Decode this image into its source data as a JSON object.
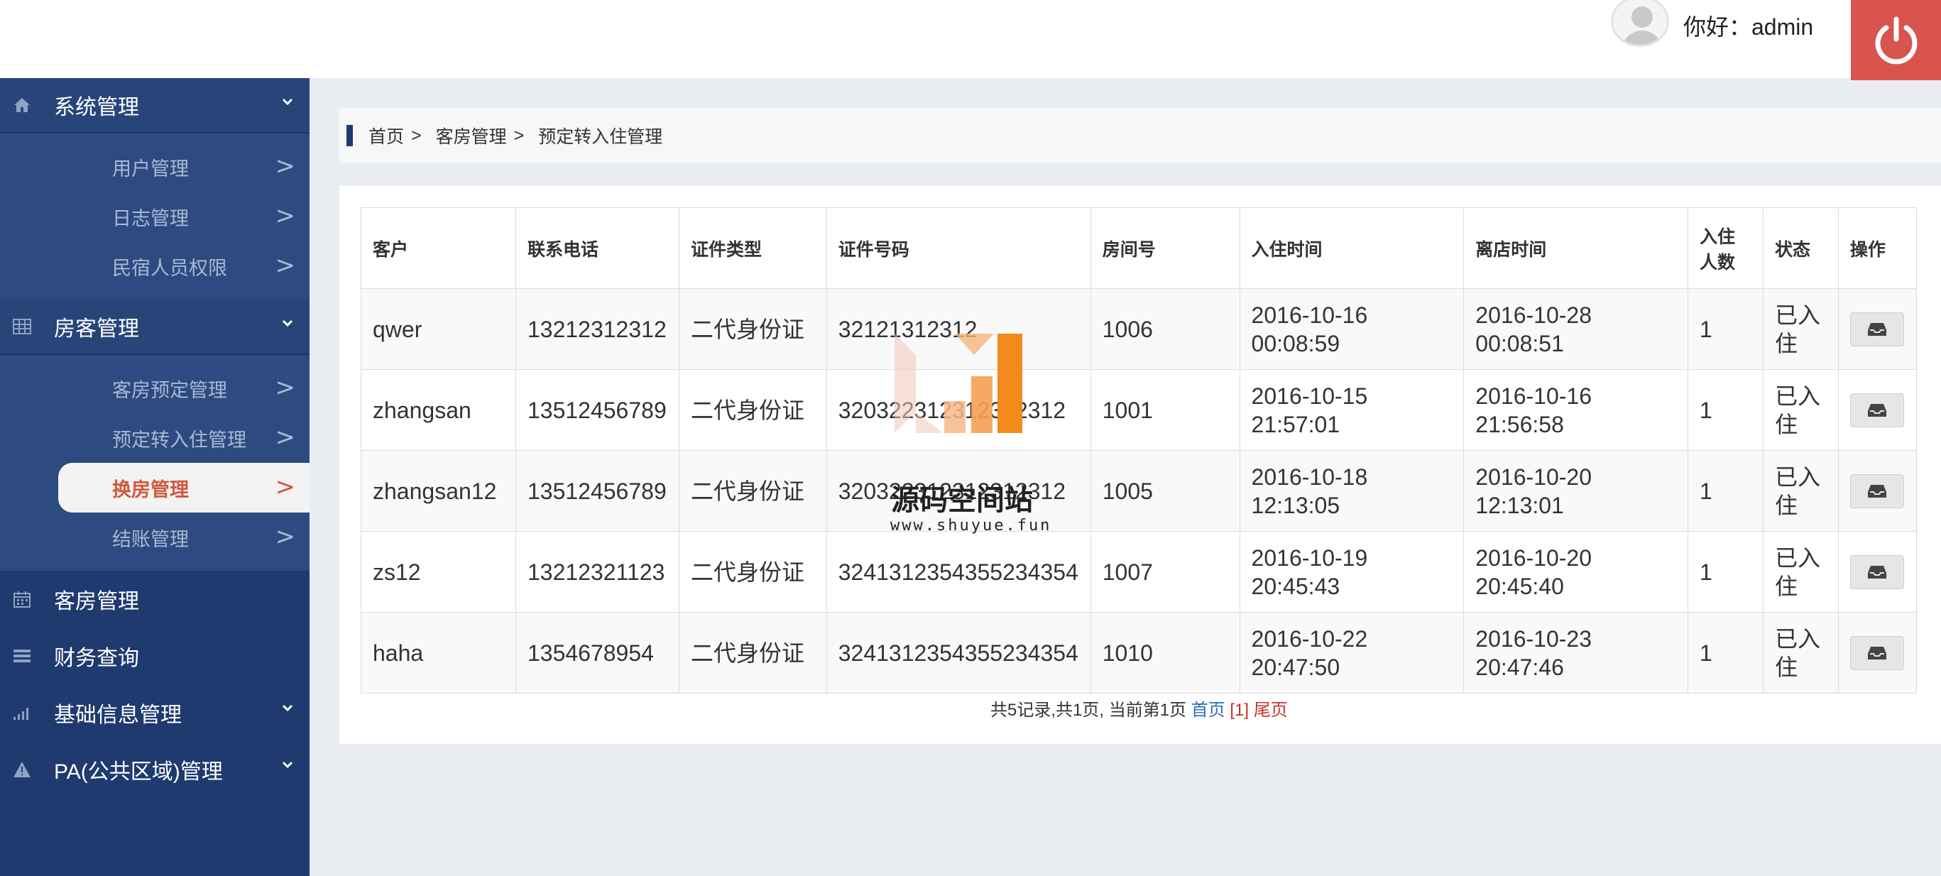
{
  "header": {
    "greeting": "你好：admin"
  },
  "sidebar": {
    "groups": [
      {
        "label": "系统管理",
        "icon": "home-icon"
      },
      {
        "label": "房客管理",
        "icon": "table-icon"
      },
      {
        "label": "客房管理",
        "icon": "calendar-icon"
      },
      {
        "label": "财务查询",
        "icon": "list-icon"
      },
      {
        "label": "基础信息管理",
        "icon": "signal-icon"
      },
      {
        "label": "PA(公共区域)管理",
        "icon": "warning-icon"
      }
    ],
    "system_items": [
      {
        "label": "用户管理",
        "arrow": ">"
      },
      {
        "label": "日志管理",
        "arrow": ">"
      },
      {
        "label": "民宿人员权限",
        "arrow": ">"
      }
    ],
    "guest_items": [
      {
        "label": "客房预定管理",
        "arrow": ">"
      },
      {
        "label": "预定转入住管理",
        "arrow": ">"
      },
      {
        "label": "换房管理",
        "arrow": ">"
      },
      {
        "label": "结账管理",
        "arrow": ">"
      }
    ]
  },
  "breadcrumb": {
    "items": [
      "首页",
      "客房管理",
      "预定转入住管理"
    ],
    "separator": ">"
  },
  "table": {
    "headers": [
      "客户",
      "联系电话",
      "证件类型",
      "证件号码",
      "房间号",
      "入住时间",
      "离店时间",
      "入住人数",
      "状态",
      "操作"
    ],
    "rows": [
      {
        "customer": "qwer",
        "phone": "13212312312",
        "id_type": "二代身份证",
        "id_number": "32121312312",
        "room": "1006",
        "checkin_date": "2016-10-16",
        "checkin_time": "00:08:59",
        "checkout_date": "2016-10-28",
        "checkout_time": "00:08:51",
        "guests": "1",
        "status": "已入住"
      },
      {
        "customer": "zhangsan",
        "phone": "13512456789",
        "id_type": "二代身份证",
        "id_number": "320322312312312312",
        "room": "1001",
        "checkin_date": "2016-10-15",
        "checkin_time": "21:57:01",
        "checkout_date": "2016-10-16",
        "checkout_time": "21:56:58",
        "guests": "1",
        "status": "已入住"
      },
      {
        "customer": "zhangsan12",
        "phone": "13512456789",
        "id_type": "二代身份证",
        "id_number": "320322312312312312",
        "room": "1005",
        "checkin_date": "2016-10-18",
        "checkin_time": "12:13:05",
        "checkout_date": "2016-10-20",
        "checkout_time": "12:13:01",
        "guests": "1",
        "status": "已入住"
      },
      {
        "customer": "zs12",
        "phone": "13212321123",
        "id_type": "二代身份证",
        "id_number": "3241312354355234354",
        "room": "1007",
        "checkin_date": "2016-10-19",
        "checkin_time": "20:45:43",
        "checkout_date": "2016-10-20",
        "checkout_time": "20:45:40",
        "guests": "1",
        "status": "已入住"
      },
      {
        "customer": "haha",
        "phone": "1354678954",
        "id_type": "二代身份证",
        "id_number": "3241312354355234354",
        "room": "1010",
        "checkin_date": "2016-10-22",
        "checkin_time": "20:47:50",
        "checkout_date": "2016-10-23",
        "checkout_time": "20:47:46",
        "guests": "1",
        "status": "已入住"
      }
    ]
  },
  "pager": {
    "summary": "共5记录,共1页, 当前第1页",
    "first": "首页",
    "current": "[1]",
    "last": "尾页"
  },
  "watermark": {
    "text": "源码空间站",
    "url": "www.shuyue.fun"
  }
}
